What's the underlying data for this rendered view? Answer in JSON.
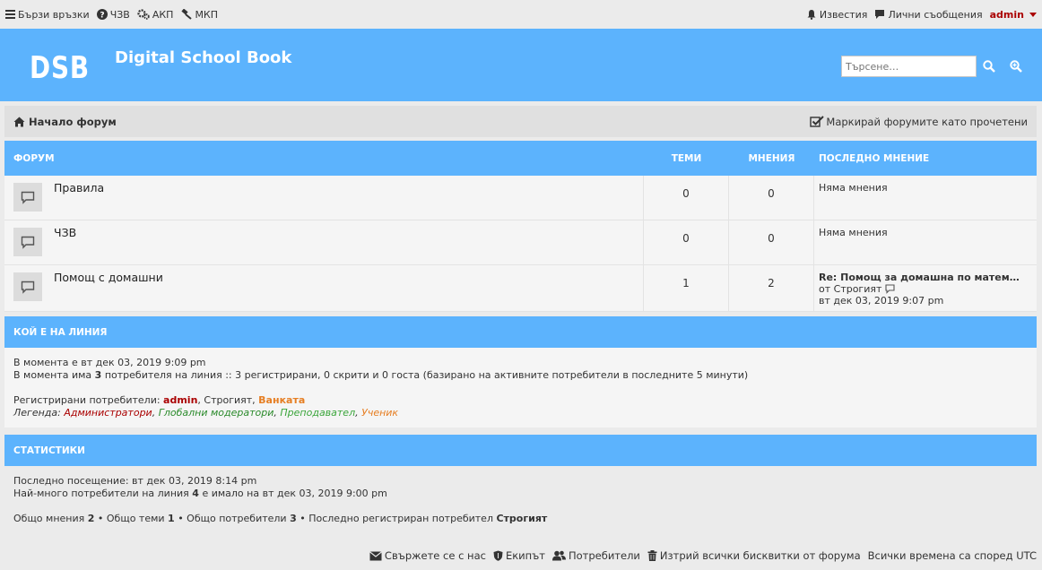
{
  "topbar": {
    "quick_links": "Бързи връзки",
    "faq": "ЧЗВ",
    "acp": "АКП",
    "mcp": "МКП",
    "notifications": "Известия",
    "private_messages": "Лични съобщения",
    "username": "admin"
  },
  "header": {
    "logo": "DSB",
    "site_title": "Digital School Book",
    "search_placeholder": "Търсене…"
  },
  "navbar": {
    "home": "Начало форум",
    "mark_read": "Маркирай форумите като прочетени"
  },
  "forums": {
    "headers": {
      "forum": "Форум",
      "topics": "Теми",
      "posts": "Мнения",
      "last_post": "Последно мнение"
    },
    "rows": [
      {
        "name": "Правила",
        "topics": "0",
        "posts": "0",
        "last_post": "Няма мнения"
      },
      {
        "name": "ЧЗВ",
        "topics": "0",
        "posts": "0",
        "last_post": "Няма мнения"
      },
      {
        "name": "Помощ с домашни",
        "topics": "1",
        "posts": "2",
        "last_post_title": "Re: Помощ за домашна по матем…",
        "last_post_by": "от Строгият",
        "last_post_time": "вт дек 03, 2019 9:07 pm"
      }
    ]
  },
  "online": {
    "heading": "Кой е на линия",
    "current_time": "В момента е вт дек 03, 2019 9:09 pm",
    "line_pre": "В момента има ",
    "count": "3",
    "line_post": " потребителя на линия :: 3 регистрирани, 0 скрити и 0 госта (базирано на активните потребители в последните 5 минути)",
    "registered_label": "Регистрирани потребители: ",
    "user_admin": "admin",
    "user_sep1": ", Строгият, ",
    "user_teacher": "Ванката",
    "legend_label": "Легенда: ",
    "legend_admin": "Администратори",
    "legend_gmod": "Глобални модератори",
    "legend_teacher": "Преподавател",
    "legend_student": "Ученик"
  },
  "stats": {
    "heading": "Статистики",
    "last_visit": "Последно посещение: вт дек 03, 2019 8:14 pm",
    "most_pre": "Най-много потребители на линия ",
    "most_count": "4",
    "most_post": " е имало на вт дек 03, 2019 9:00 pm",
    "total_posts_label": "Общо мнения ",
    "total_posts": "2",
    "total_topics_label": " • Общо теми ",
    "total_topics": "1",
    "total_users_label": " • Общо потребители ",
    "total_users": "3",
    "newest_label": " • Последно регистриран потребител ",
    "newest_user": "Строгият"
  },
  "footer": {
    "contact": "Свържете се с нас",
    "team": "Екипът",
    "members": "Потребители",
    "delete_cookies": "Изтрий всички бисквитки от форума",
    "timezone": "Всички времена са според UTC"
  },
  "colors": {
    "accent": "#5cb3fd",
    "admin": "#aa0000",
    "teacher": "#e67e22"
  }
}
